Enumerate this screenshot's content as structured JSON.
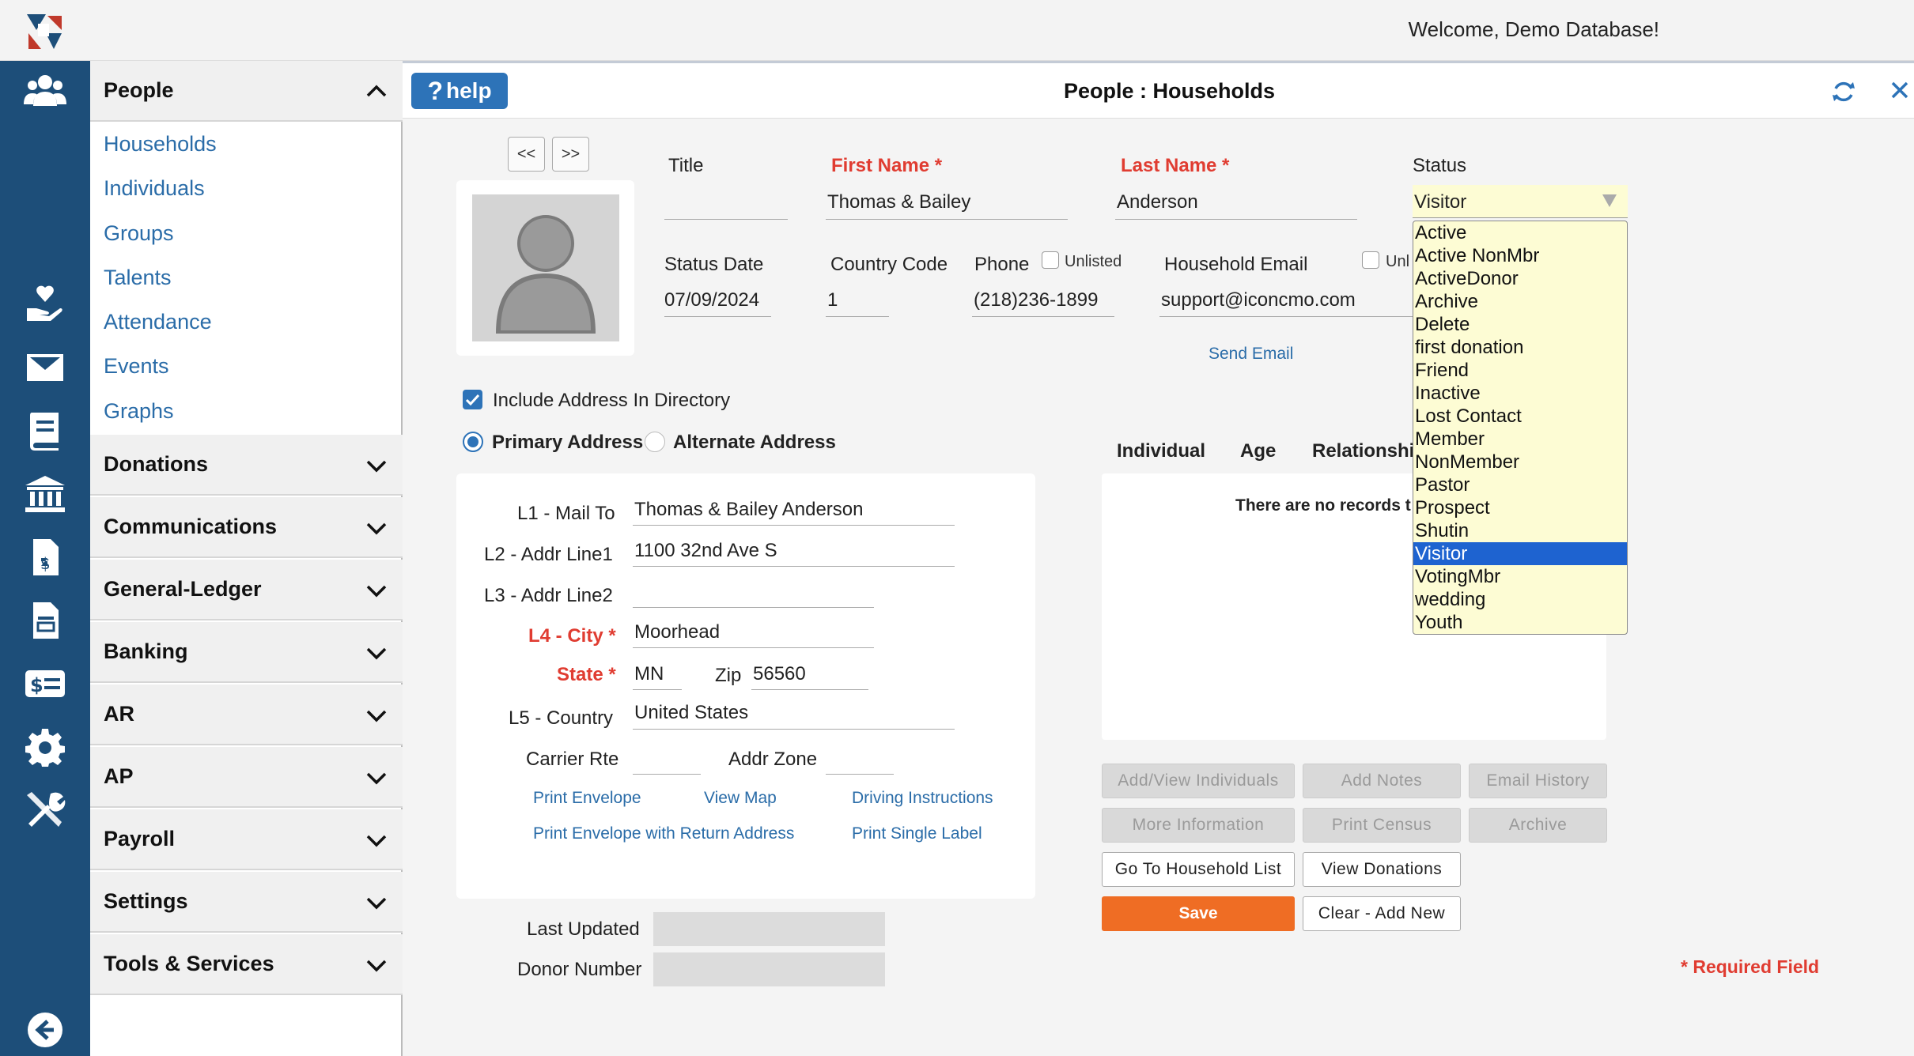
{
  "header": {
    "welcome": "Welcome, Demo Database!"
  },
  "menu": {
    "people": {
      "label": "People",
      "items": [
        "Households",
        "Individuals",
        "Groups",
        "Talents",
        "Attendance",
        "Events",
        "Graphs"
      ]
    },
    "sections": [
      "Donations",
      "Communications",
      "General-Ledger",
      "Banking",
      "AR",
      "AP",
      "Payroll",
      "Settings",
      "Tools & Services"
    ]
  },
  "page": {
    "help_label": "help",
    "title": "People : Households",
    "prev": "<<",
    "next": ">>"
  },
  "form": {
    "title_label": "Title",
    "title_value": "",
    "first_name_label": "First Name *",
    "first_name_value": "Thomas & Bailey",
    "last_name_label": "Last Name *",
    "last_name_value": "Anderson",
    "status_label": "Status",
    "status_value": "Visitor",
    "status_date_label": "Status Date",
    "status_date_value": "07/09/2024",
    "country_code_label": "Country Code",
    "country_code_value": "1",
    "phone_label": "Phone",
    "phone_unlisted": "Unlisted",
    "phone_value": "(218)236-1899",
    "email_label": "Household Email",
    "email_unlisted": "Unl",
    "email_value": "support@iconcmo.com",
    "send_email": "Send Email",
    "include_directory": "Include Address In Directory",
    "primary_address": "Primary Address",
    "alternate_address": "Alternate Address"
  },
  "address": {
    "l1_label": "L1 - Mail To",
    "l1_value": "Thomas & Bailey Anderson",
    "l2_label": "L2 - Addr Line1",
    "l2_value": "1100 32nd Ave S",
    "l3_label": "L3 - Addr Line2",
    "l3_value": "",
    "l4_label": "L4 - City *",
    "l4_value": "Moorhead",
    "state_label": "State *",
    "state_value": "MN",
    "zip_label": "Zip",
    "zip_value": "56560",
    "l5_label": "L5 - Country",
    "l5_value": "United States",
    "carrier_label": "Carrier Rte",
    "carrier_value": "",
    "zone_label": "Addr Zone",
    "zone_value": "",
    "links": [
      "Print Envelope",
      "View Map",
      "Driving Instructions",
      "Print Envelope with Return Address",
      "Print Single Label"
    ]
  },
  "meta": {
    "last_updated_label": "Last Updated",
    "donor_number_label": "Donor Number"
  },
  "table": {
    "columns": [
      "Individual",
      "Age",
      "Relationshi"
    ],
    "empty": "There are no records t"
  },
  "buttons": {
    "add_view": "Add/View Individuals",
    "add_notes": "Add Notes",
    "email_history": "Email History",
    "more_info": "More Information",
    "print_census": "Print Census",
    "archive": "Archive",
    "go_list": "Go To Household List",
    "view_donations": "View Donations",
    "save": "Save",
    "clear_add": "Clear - Add New"
  },
  "required_note": "* Required Field",
  "status_options": [
    "Active",
    "Active NonMbr",
    "ActiveDonor",
    "Archive",
    "Delete",
    "first donation",
    "Friend",
    "Inactive",
    "Lost Contact",
    "Member",
    "NonMember",
    "Pastor",
    "Prospect",
    "Shutin",
    "Visitor",
    "VotingMbr",
    "wedding",
    "Youth"
  ],
  "selected_status": "Visitor",
  "colors": {
    "rail": "#1d4e79",
    "accent": "#2d73b8",
    "required": "#e03c31",
    "save": "#ef6d24",
    "dropdown_bg": "#fdfcd4",
    "selected": "#1e63d0"
  }
}
